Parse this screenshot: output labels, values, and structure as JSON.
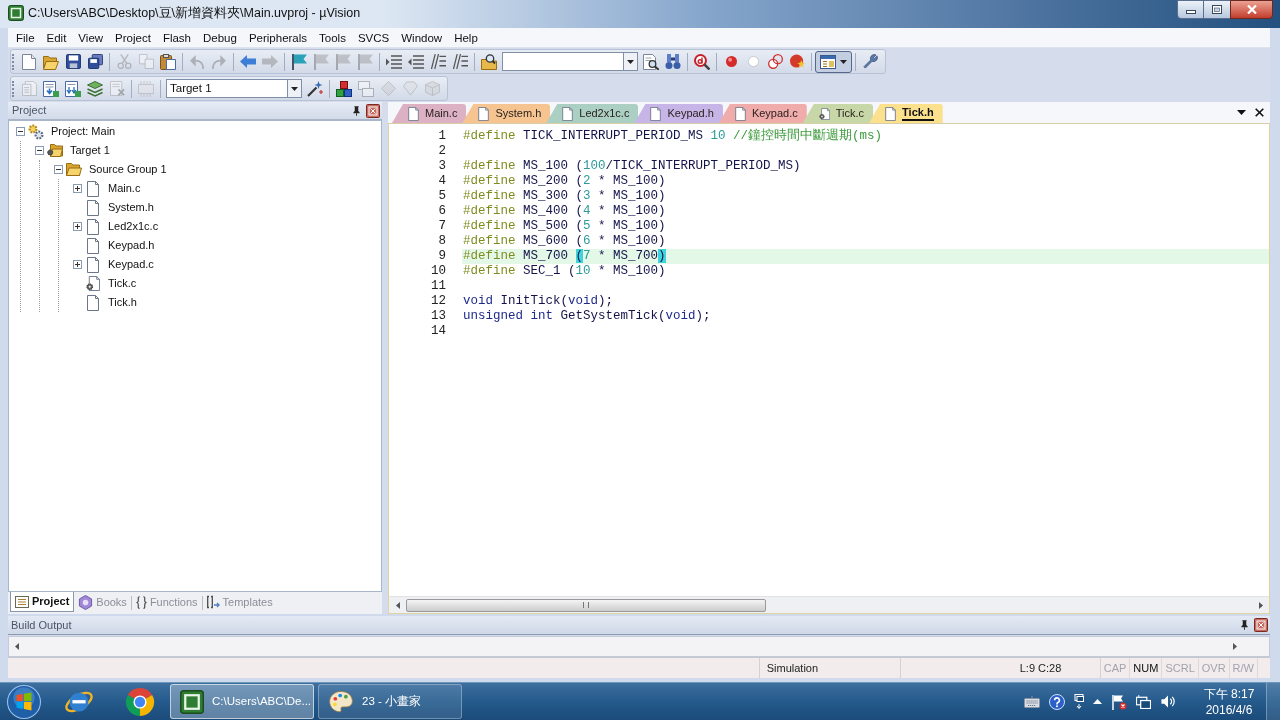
{
  "window": {
    "title": "C:\\Users\\ABC\\Desktop\\豆\\新增資料夾\\Main.uvproj - µVision"
  },
  "menu": [
    "File",
    "Edit",
    "View",
    "Project",
    "Flash",
    "Debug",
    "Peripherals",
    "Tools",
    "SVCS",
    "Window",
    "Help"
  ],
  "toolbar_1": [
    [
      {
        "kind": "button",
        "disabled": false
      },
      {
        "kind": "button",
        "disabled": false
      },
      {
        "kind": "button",
        "disabled": false
      },
      {
        "kind": "button",
        "disabled": false
      }
    ],
    [
      {
        "kind": "button",
        "disabled": true
      },
      {
        "kind": "button",
        "disabled": true
      },
      {
        "kind": "button",
        "disabled": false
      }
    ],
    [
      {
        "kind": "button",
        "disabled": true
      },
      {
        "kind": "button",
        "disabled": true
      }
    ],
    [
      {
        "kind": "button",
        "disabled": false
      },
      {
        "kind": "button",
        "disabled": true
      }
    ],
    [
      {
        "kind": "button",
        "disabled": false
      },
      {
        "kind": "button",
        "disabled": true
      },
      {
        "kind": "button",
        "disabled": true
      },
      {
        "kind": "button",
        "disabled": true
      }
    ],
    [
      {
        "kind": "button",
        "disabled": false
      },
      {
        "kind": "button",
        "disabled": false
      },
      {
        "kind": "button",
        "disabled": false
      },
      {
        "kind": "button",
        "disabled": false
      }
    ],
    [
      {
        "kind": "button",
        "disabled": false
      },
      {
        "kind": "combo"
      },
      {
        "kind": "button",
        "disabled": false
      },
      {
        "kind": "button",
        "disabled": false
      }
    ],
    [
      {
        "kind": "button",
        "disabled": false
      }
    ],
    [
      {
        "kind": "button",
        "disabled": false
      },
      {
        "kind": "button",
        "disabled": false
      },
      {
        "kind": "button",
        "disabled": false
      },
      {
        "kind": "button",
        "disabled": false
      }
    ],
    [
      {
        "kind": "split",
        "pressed": true
      }
    ],
    [
      {
        "kind": "button",
        "disabled": false
      }
    ]
  ],
  "toolbar_2": [
    [
      {
        "kind": "button",
        "disabled": true
      },
      {
        "kind": "button",
        "disabled": false
      },
      {
        "kind": "button",
        "disabled": false
      },
      {
        "kind": "button",
        "disabled": false
      },
      {
        "kind": "button",
        "disabled": true
      }
    ],
    [
      {
        "kind": "button",
        "disabled": true
      }
    ],
    [
      {
        "kind": "combo",
        "value": "Target 1"
      },
      {
        "kind": "button",
        "disabled": false
      }
    ],
    [
      {
        "kind": "button",
        "disabled": false
      },
      {
        "kind": "button",
        "disabled": true
      },
      {
        "kind": "button",
        "disabled": true
      },
      {
        "kind": "button",
        "disabled": true
      },
      {
        "kind": "button",
        "disabled": true
      }
    ]
  ],
  "project_panel": {
    "title": "Project",
    "tree": [
      {
        "label": "Project: Main",
        "kind": "project",
        "expandable": true,
        "expanded": true,
        "children": [
          {
            "label": "Target 1",
            "kind": "target",
            "expandable": true,
            "expanded": true,
            "children": [
              {
                "label": "Source Group 1",
                "kind": "group",
                "expandable": true,
                "expanded": true,
                "children": [
                  {
                    "label": "Main.c",
                    "kind": "file",
                    "expandable": true,
                    "expanded": false
                  },
                  {
                    "label": "System.h",
                    "kind": "file",
                    "expandable": false
                  },
                  {
                    "label": "Led2x1c.c",
                    "kind": "file",
                    "expandable": true,
                    "expanded": false
                  },
                  {
                    "label": "Keypad.h",
                    "kind": "file",
                    "expandable": false
                  },
                  {
                    "label": "Keypad.c",
                    "kind": "file",
                    "expandable": true,
                    "expanded": false
                  },
                  {
                    "label": "Tick.c",
                    "kind": "file_options",
                    "expandable": false
                  },
                  {
                    "label": "Tick.h",
                    "kind": "file",
                    "expandable": false
                  }
                ]
              }
            ]
          }
        ]
      }
    ],
    "tabs": [
      {
        "label": "Project",
        "selected": true
      },
      {
        "label": "Books",
        "selected": false
      },
      {
        "label": "Functions",
        "selected": false
      },
      {
        "label": "Templates",
        "selected": false
      }
    ]
  },
  "editor": {
    "tabs": [
      {
        "label": "Main.c",
        "kind": "file",
        "color": "#dcb1c4",
        "selected": false
      },
      {
        "label": "System.h",
        "kind": "file",
        "color": "#f5c491",
        "selected": false
      },
      {
        "label": "Led2x1c.c",
        "kind": "file",
        "color": "#abcfc3",
        "selected": false
      },
      {
        "label": "Keypad.h",
        "kind": "file",
        "color": "#c6b5e6",
        "selected": false
      },
      {
        "label": "Keypad.c",
        "kind": "file",
        "color": "#f0abab",
        "selected": false
      },
      {
        "label": "Tick.c",
        "kind": "file_options",
        "color": "#c7d7a8",
        "selected": false
      },
      {
        "label": "Tick.h",
        "kind": "file",
        "color": "#fbe08e",
        "selected": true
      }
    ],
    "lines": [
      {
        "number": "1",
        "current": false,
        "tokens": [
          {
            "kind": "preprocessor",
            "text": "#define"
          },
          {
            "kind": "plain",
            "text": " TICK_INTERRUPT_PERIOD_MS "
          },
          {
            "kind": "number",
            "text": "10"
          },
          {
            "kind": "comment",
            "text": " //鐘控時間中斷週期(ms)"
          }
        ]
      },
      {
        "number": "2",
        "current": false
      },
      {
        "number": "3",
        "current": false,
        "tokens": [
          {
            "kind": "preprocessor",
            "text": "#define"
          },
          {
            "kind": "plain",
            "text": " MS_100 ("
          },
          {
            "kind": "number",
            "text": "100"
          },
          {
            "kind": "plain",
            "text": "/TICK_INTERRUPT_PERIOD_MS)"
          }
        ]
      },
      {
        "number": "4",
        "current": false,
        "tokens": [
          {
            "kind": "preprocessor",
            "text": "#define"
          },
          {
            "kind": "plain",
            "text": " MS_200 ("
          },
          {
            "kind": "number",
            "text": "2"
          },
          {
            "kind": "plain",
            "text": " * MS_100)"
          }
        ]
      },
      {
        "number": "5",
        "current": false,
        "tokens": [
          {
            "kind": "preprocessor",
            "text": "#define"
          },
          {
            "kind": "plain",
            "text": " MS_300 ("
          },
          {
            "kind": "number",
            "text": "3"
          },
          {
            "kind": "plain",
            "text": " * MS_100)"
          }
        ]
      },
      {
        "number": "6",
        "current": false,
        "tokens": [
          {
            "kind": "preprocessor",
            "text": "#define"
          },
          {
            "kind": "plain",
            "text": " MS_400 ("
          },
          {
            "kind": "number",
            "text": "4"
          },
          {
            "kind": "plain",
            "text": " * MS_100)"
          }
        ]
      },
      {
        "number": "7",
        "current": false,
        "tokens": [
          {
            "kind": "preprocessor",
            "text": "#define"
          },
          {
            "kind": "plain",
            "text": " MS_500 ("
          },
          {
            "kind": "number",
            "text": "5"
          },
          {
            "kind": "plain",
            "text": " * MS_100)"
          }
        ]
      },
      {
        "number": "8",
        "current": false,
        "tokens": [
          {
            "kind": "preprocessor",
            "text": "#define"
          },
          {
            "kind": "plain",
            "text": " MS_600 ("
          },
          {
            "kind": "number",
            "text": "6"
          },
          {
            "kind": "plain",
            "text": " * MS_100)"
          }
        ]
      },
      {
        "number": "9",
        "current": true,
        "tokens": [
          {
            "kind": "preprocessor",
            "text": "#define"
          },
          {
            "kind": "plain",
            "text": " MS_700 "
          },
          {
            "kind": "brace_match",
            "text": "("
          },
          {
            "kind": "number",
            "text": "7"
          },
          {
            "kind": "plain",
            "text": " * MS_700"
          },
          {
            "kind": "brace_match",
            "text": ")"
          }
        ]
      },
      {
        "number": "10",
        "current": false,
        "tokens": [
          {
            "kind": "preprocessor",
            "text": "#define"
          },
          {
            "kind": "plain",
            "text": " SEC_1 ("
          },
          {
            "kind": "number",
            "text": "10"
          },
          {
            "kind": "plain",
            "text": " * MS_100)"
          }
        ]
      },
      {
        "number": "11",
        "current": false
      },
      {
        "number": "12",
        "current": false,
        "tokens": [
          {
            "kind": "keyword",
            "text": "void"
          },
          {
            "kind": "plain",
            "text": " InitTick("
          },
          {
            "kind": "keyword",
            "text": "void"
          },
          {
            "kind": "plain",
            "text": ");"
          }
        ]
      },
      {
        "number": "13",
        "current": false,
        "tokens": [
          {
            "kind": "keyword",
            "text": "unsigned int"
          },
          {
            "kind": "plain",
            "text": " GetSystemTick("
          },
          {
            "kind": "keyword",
            "text": "void"
          },
          {
            "kind": "plain",
            "text": ");"
          }
        ]
      },
      {
        "number": "14",
        "current": false
      }
    ]
  },
  "build_output": {
    "title": "Build Output"
  },
  "status_bar": {
    "mode": "Simulation",
    "position": "L:9 C:28",
    "indicators": [
      {
        "label": "CAP",
        "on": false
      },
      {
        "label": "NUM",
        "on": true
      },
      {
        "label": "SCRL",
        "on": false
      },
      {
        "label": "OVR",
        "on": false
      },
      {
        "label": "R/W",
        "on": false
      }
    ]
  },
  "taskbar": {
    "tasks": [
      {
        "label": "C:\\Users\\ABC\\De...",
        "kind": "ide",
        "selected": true
      },
      {
        "label": "23 - 小畫家",
        "kind": "paint",
        "selected": false
      }
    ],
    "clock": {
      "time": "下午 8:17",
      "date": "2016/4/6"
    }
  }
}
